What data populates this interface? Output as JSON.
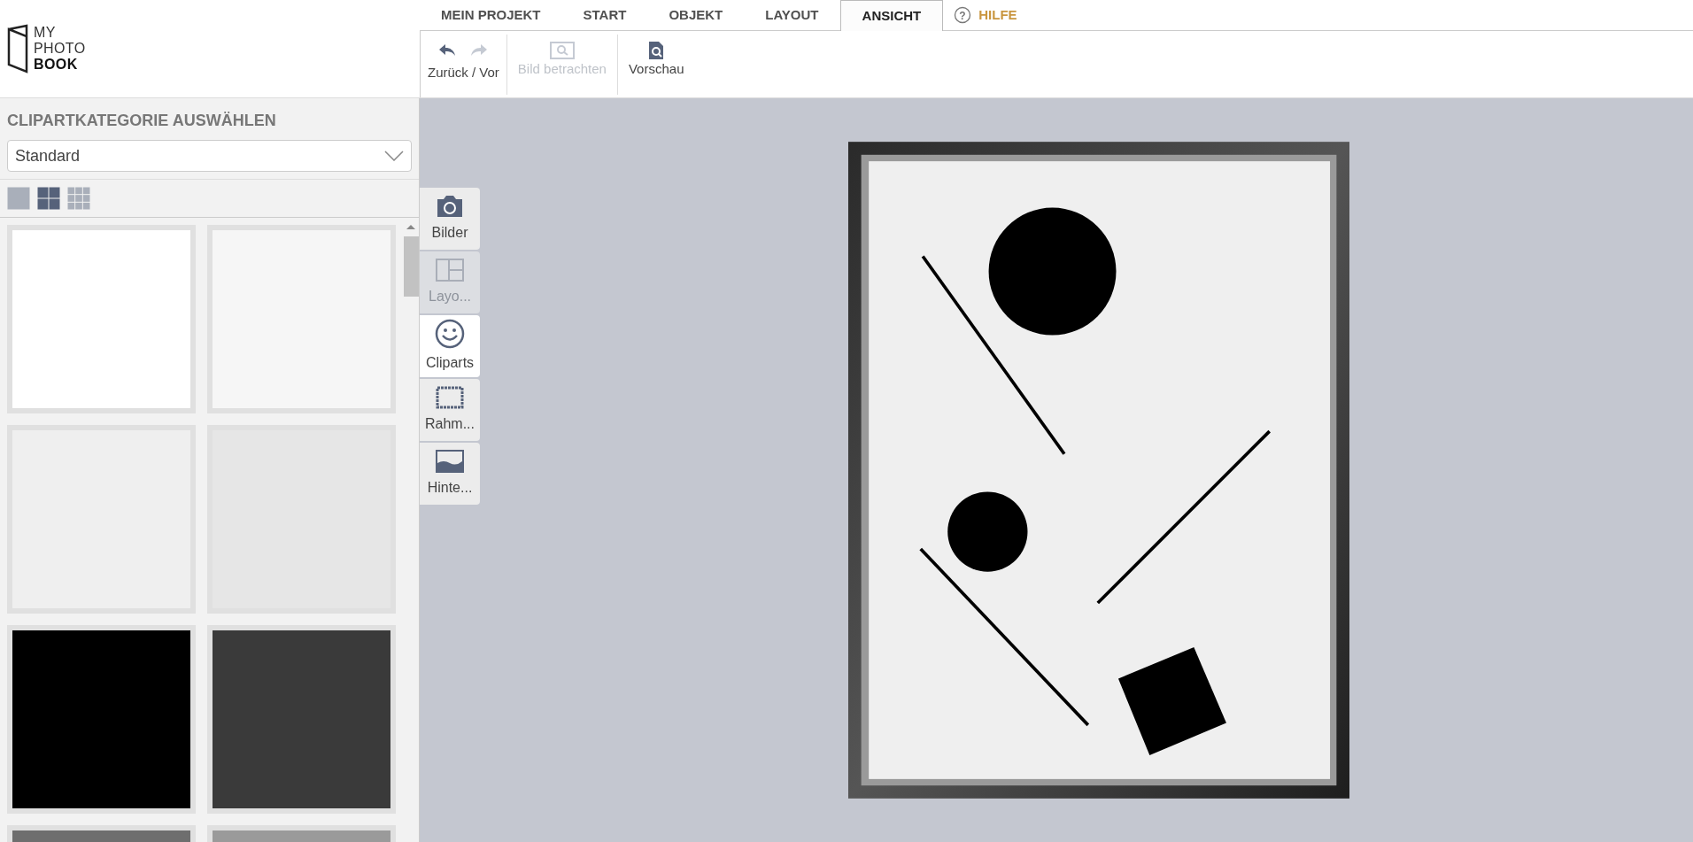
{
  "logo": {
    "lines": [
      "MY",
      "PHOTO",
      "BOOK"
    ]
  },
  "tabs": [
    {
      "label": "MEIN PROJEKT",
      "selected": false
    },
    {
      "label": "START",
      "selected": false
    },
    {
      "label": "OBJEKT",
      "selected": false
    },
    {
      "label": "LAYOUT",
      "selected": false
    },
    {
      "label": "ANSICHT",
      "selected": true
    }
  ],
  "help": {
    "icon": "?",
    "label": "HILFE"
  },
  "toolbar": [
    {
      "kind": "undo_redo",
      "label": "Zurück / Vor",
      "redo_disabled": true,
      "disabled": false
    },
    {
      "kind": "view_image",
      "label": "Bild betrachten",
      "disabled": true
    },
    {
      "kind": "preview",
      "label": "Vorschau",
      "disabled": false
    }
  ],
  "sidebar": {
    "title": "CLIPARTKATEGORIE AUSWÄHLEN",
    "category": "Standard",
    "view_sizes": [
      {
        "kind": "large",
        "selected": false
      },
      {
        "kind": "medium",
        "selected": true
      },
      {
        "kind": "small",
        "selected": false
      }
    ],
    "tiles": [
      {
        "color": "#ffffff"
      },
      {
        "color": "#f6f6f6"
      },
      {
        "color": "#efefef"
      },
      {
        "color": "#e6e6e6"
      },
      {
        "color": "#000000"
      },
      {
        "color": "#3a3a3a"
      },
      {
        "color": "#6e6e6e"
      },
      {
        "color": "#9a9a9a"
      }
    ]
  },
  "side_tabs": [
    {
      "kind": "images",
      "label": "Bilder",
      "selected": false,
      "disabled": false
    },
    {
      "kind": "layouts",
      "label": "Layo...",
      "selected": false,
      "disabled": true
    },
    {
      "kind": "cliparts",
      "label": "Cliparts",
      "selected": true,
      "disabled": false
    },
    {
      "kind": "frames",
      "label": "Rahm...",
      "selected": false,
      "disabled": false
    },
    {
      "kind": "backgrounds",
      "label": "Hinte...",
      "selected": false,
      "disabled": false
    }
  ]
}
